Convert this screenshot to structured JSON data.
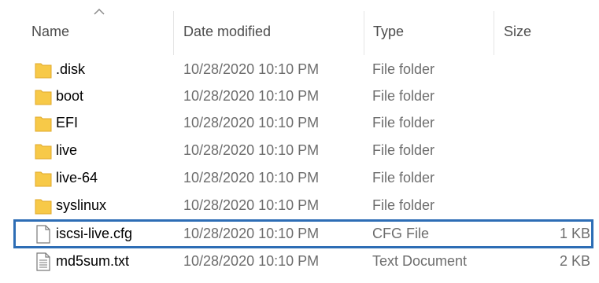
{
  "columns": {
    "name": "Name",
    "date": "Date modified",
    "type": "Type",
    "size": "Size"
  },
  "files": [
    {
      "name": ".disk",
      "date": "10/28/2020 10:10 PM",
      "type": "File folder",
      "size": "",
      "icon": "folder-icon"
    },
    {
      "name": "boot",
      "date": "10/28/2020 10:10 PM",
      "type": "File folder",
      "size": "",
      "icon": "folder-icon"
    },
    {
      "name": "EFI",
      "date": "10/28/2020 10:10 PM",
      "type": "File folder",
      "size": "",
      "icon": "folder-icon"
    },
    {
      "name": "live",
      "date": "10/28/2020 10:10 PM",
      "type": "File folder",
      "size": "",
      "icon": "folder-icon"
    },
    {
      "name": "live-64",
      "date": "10/28/2020 10:10 PM",
      "type": "File folder",
      "size": "",
      "icon": "folder-icon"
    },
    {
      "name": "syslinux",
      "date": "10/28/2020 10:10 PM",
      "type": "File folder",
      "size": "",
      "icon": "folder-icon"
    },
    {
      "name": "iscsi-live.cfg",
      "date": "10/28/2020 10:10 PM",
      "type": "CFG File",
      "size": "1 KB",
      "icon": "file-icon",
      "highlighted": true
    },
    {
      "name": "md5sum.txt",
      "date": "10/28/2020 10:10 PM",
      "type": "Text Document",
      "size": "2 KB",
      "icon": "text-file-icon"
    }
  ],
  "colors": {
    "folder": "#f7c948",
    "highlight_border": "#2d6db5"
  }
}
